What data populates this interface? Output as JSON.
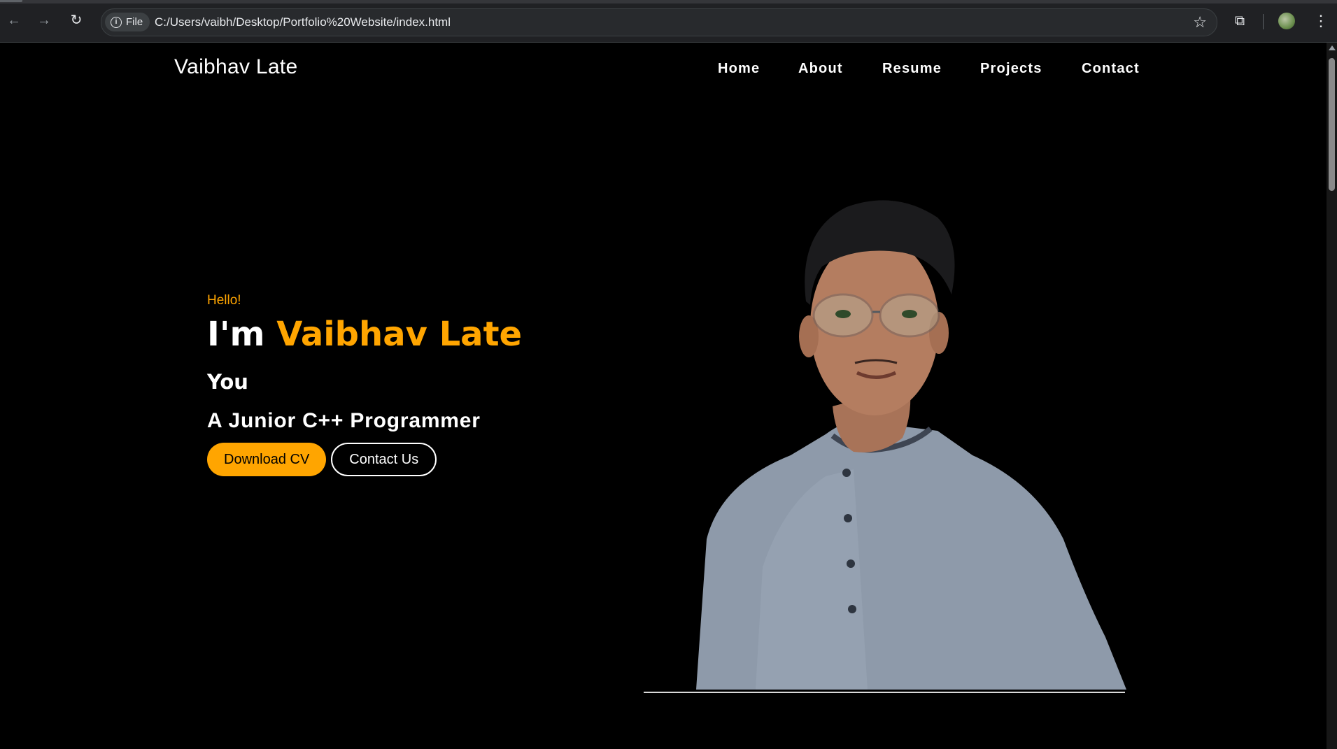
{
  "browser": {
    "chip_label": "File",
    "url": "C:/Users/vaibh/Desktop/Portfolio%20Website/index.html",
    "icons": [
      "back-arrow-icon",
      "forward-arrow-icon",
      "reload-icon",
      "info-icon",
      "star-icon",
      "extensions-icon",
      "profile-avatar",
      "more-menu-icon"
    ]
  },
  "site": {
    "brand": "Vaibhav Late",
    "nav": [
      "Home",
      "About",
      "Resume",
      "Projects",
      "Contact"
    ]
  },
  "hero": {
    "greeting": "Hello!",
    "intro": "I'm",
    "name": "Vaibhav Late",
    "typed_word": "You",
    "role": "A Junior C++ Programmer",
    "primary_button": "Download CV",
    "secondary_button": "Contact Us"
  },
  "colors": {
    "accent": "#ffa500",
    "background": "#000000",
    "text": "#ffffff"
  }
}
